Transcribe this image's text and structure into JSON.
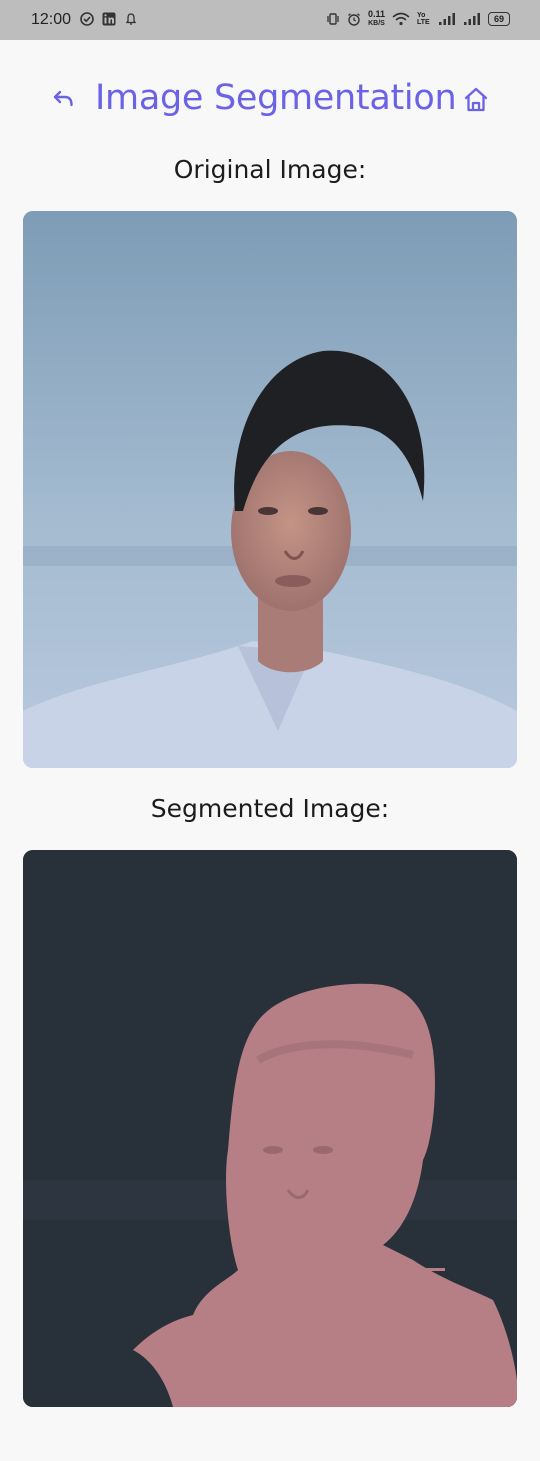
{
  "status_bar": {
    "time": "12:00",
    "net_speed_value": "0.11",
    "net_speed_unit": "KB/S",
    "network_type": "Yo LTE",
    "battery": "69"
  },
  "header": {
    "title": "Image Segmentation",
    "back_icon": "back-arrow-icon",
    "home_icon": "home-icon"
  },
  "original": {
    "label": "Original Image:"
  },
  "segmented": {
    "label": "Segmented Image:"
  },
  "colors": {
    "accent": "#6b63e6",
    "segment_mask": "#b67f86",
    "segment_background": "#2a323b"
  }
}
